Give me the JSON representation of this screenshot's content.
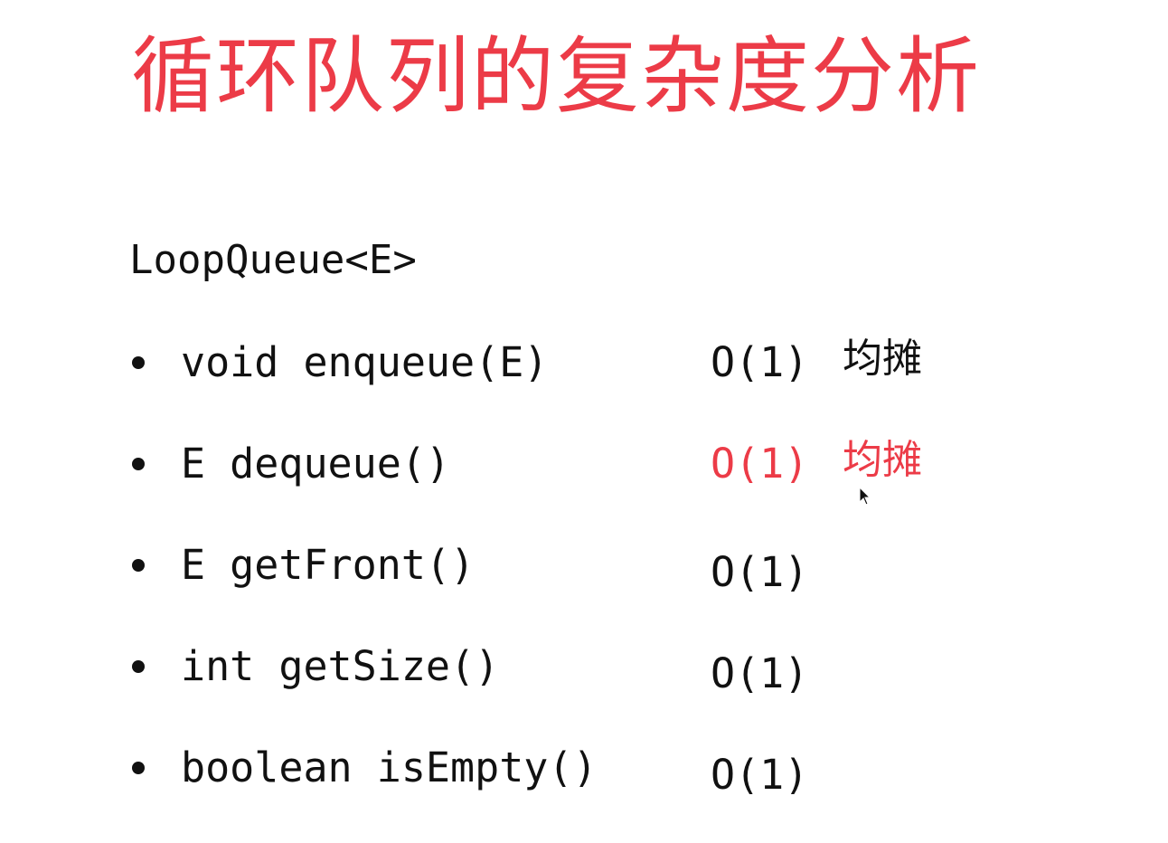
{
  "title": "循环队列的复杂度分析",
  "class_name": "LoopQueue<E>",
  "methods": [
    {
      "signature": "void enqueue(E)",
      "complexity": "O(1)",
      "note": "均摊"
    },
    {
      "signature": "E dequeue()",
      "complexity": "O(1)",
      "note": "均摊"
    },
    {
      "signature": "E getFront()",
      "complexity": "O(1)",
      "note": ""
    },
    {
      "signature": "int getSize()",
      "complexity": "O(1)",
      "note": ""
    },
    {
      "signature": "boolean isEmpty()",
      "complexity": "O(1)",
      "note": ""
    }
  ],
  "colors": {
    "accent": "#ec3b47",
    "text": "#111111",
    "background": "#ffffff"
  },
  "icons": {
    "cursor": "mouse-pointer-icon"
  }
}
